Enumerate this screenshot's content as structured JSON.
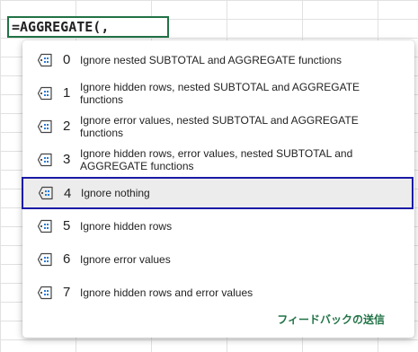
{
  "formula_bar": {
    "text": "=AGGREGATE(,"
  },
  "dropdown": {
    "icon": "function-option-icon",
    "options": [
      {
        "number": "0",
        "description": "Ignore nested SUBTOTAL and AGGREGATE functions"
      },
      {
        "number": "1",
        "description": "Ignore hidden rows, nested SUBTOTAL and AGGREGATE functions"
      },
      {
        "number": "2",
        "description": "Ignore error values, nested SUBTOTAL and AGGREGATE functions"
      },
      {
        "number": "3",
        "description": "Ignore hidden rows, error values, nested SUBTOTAL and AGGREGATE functions"
      },
      {
        "number": "4",
        "description": "Ignore nothing"
      },
      {
        "number": "5",
        "description": "Ignore hidden rows"
      },
      {
        "number": "6",
        "description": "Ignore error values"
      },
      {
        "number": "7",
        "description": "Ignore hidden rows and error values"
      }
    ],
    "selected_number": "4",
    "feedback_label": "フィードバックの送信"
  },
  "colors": {
    "accent_green": "#217346",
    "selection_border": "#1a1aa6",
    "selection_fill": "#ececec",
    "gridline": "#e1e1e1"
  }
}
